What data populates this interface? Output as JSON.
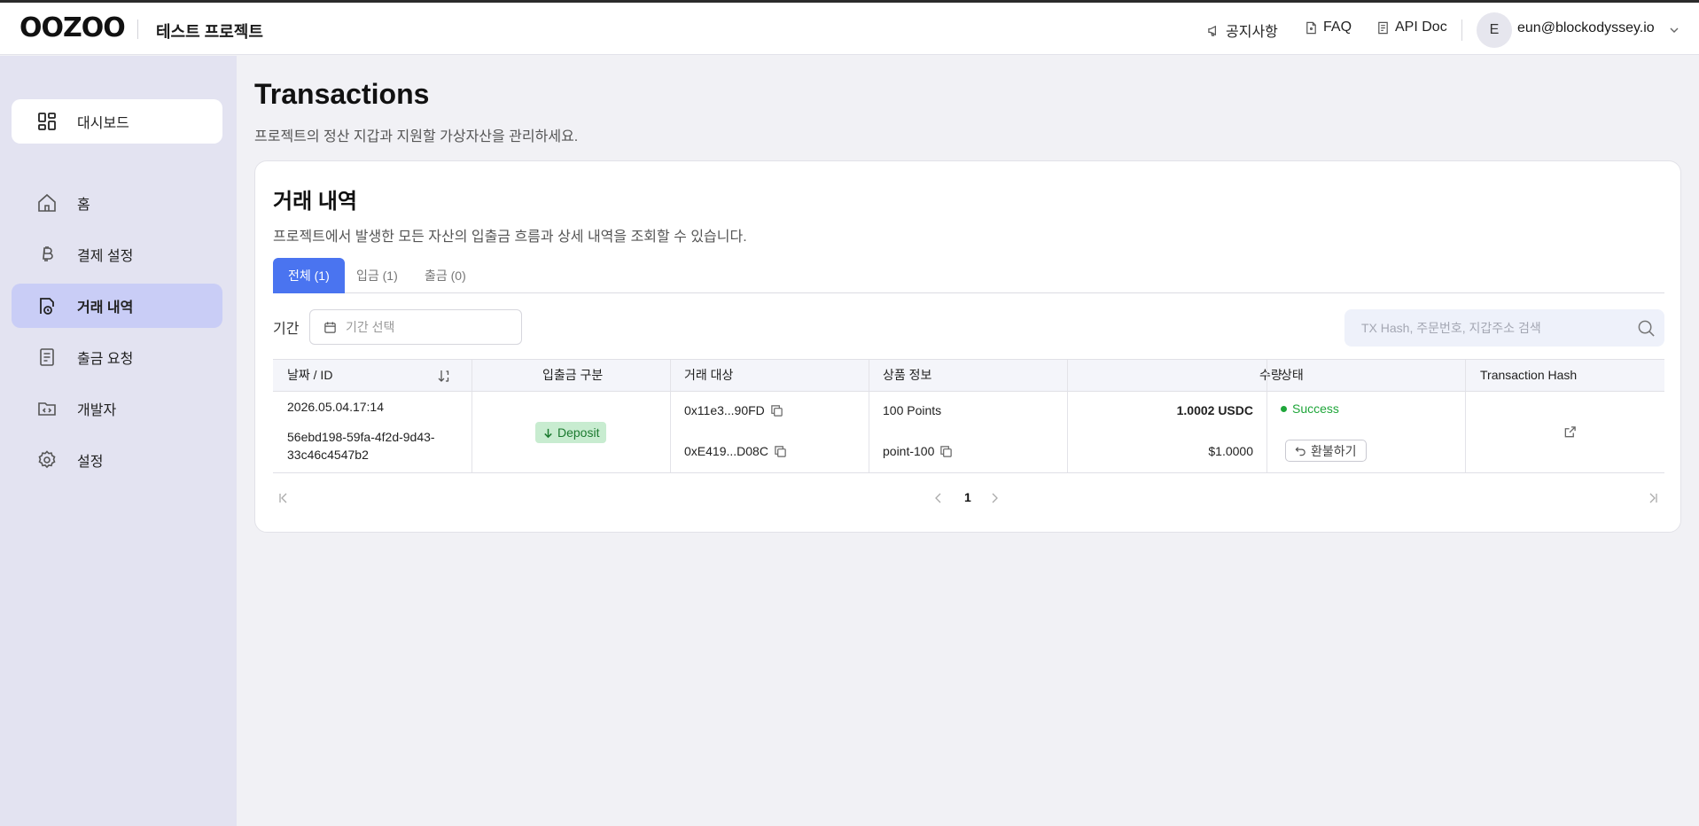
{
  "header": {
    "logo": "OOZOO",
    "project_name": "테스트 프로젝트",
    "links": [
      {
        "label": "공지사항",
        "icon": "megaphone-icon"
      },
      {
        "label": "FAQ",
        "icon": "document-icon"
      },
      {
        "label": "API Doc",
        "icon": "file-text-icon"
      }
    ],
    "user": {
      "avatar_letter": "E",
      "email": "eun@blockodyssey.io"
    }
  },
  "sidebar": {
    "items": [
      {
        "label": "대시보드",
        "icon": "dashboard-icon"
      },
      {
        "label": "홈",
        "icon": "home-icon"
      },
      {
        "label": "결제 설정",
        "icon": "bitcoin-icon"
      },
      {
        "label": "거래 내역",
        "icon": "transactions-icon",
        "active": true
      },
      {
        "label": "출금 요청",
        "icon": "withdraw-document-icon"
      },
      {
        "label": "개발자",
        "icon": "code-folder-icon"
      },
      {
        "label": "설정",
        "icon": "gear-icon"
      }
    ]
  },
  "page": {
    "title": "Transactions",
    "subtitle": "프로젝트의 정산 지갑과 지원할 가상자산을 관리하세요."
  },
  "card": {
    "title": "거래 내역",
    "description": "프로젝트에서 발생한 모든 자산의 입출금 흐름과 상세 내역을 조회할 수 있습니다.",
    "tabs": [
      {
        "label": "전체 (1)",
        "active": true
      },
      {
        "label": "입금 (1)",
        "active": false
      },
      {
        "label": "출금 (0)",
        "active": false
      }
    ],
    "filter": {
      "period_label": "기간",
      "date_placeholder": "기간 선택",
      "search_placeholder": "TX Hash, 주문번호, 지갑주소 검색"
    },
    "table": {
      "columns": [
        "날짜 / ID",
        "입출금 구분",
        "거래 대상",
        "상품 정보",
        "수량",
        "상태",
        "Transaction Hash"
      ],
      "rows": [
        {
          "date": "2026.05.04.17:14",
          "id_line1": "56ebd198-59fa-4f2d-9d43-",
          "id_line2": "33c46c4547b2",
          "type": "Deposit",
          "from_address": "0x11e3...90FD",
          "to_address": "0xE419...D08C",
          "product": "100 Points",
          "product_id": "point-100",
          "amount": "1.0002 USDC",
          "amount_fiat": "$1.0000",
          "status": "Success",
          "refund_label": "환불하기"
        }
      ]
    },
    "pagination": {
      "current_page": "1"
    }
  },
  "colors": {
    "accent": "#4a74f0",
    "sidebar_bg": "#e3e3f1",
    "sidebar_active": "#c9cdf6",
    "success": "#1fa63a",
    "deposit_bg": "#c8ecd0"
  }
}
